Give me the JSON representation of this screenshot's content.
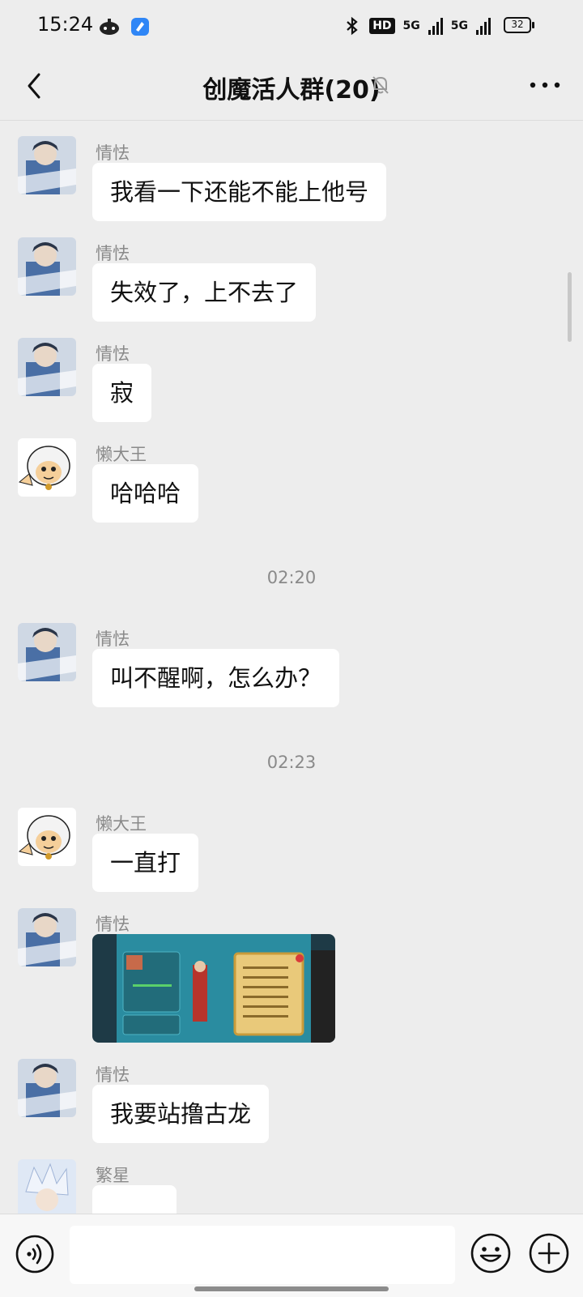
{
  "status_bar": {
    "time": "15:24",
    "hd_label": "HD",
    "sig1_label": "5G",
    "sig2_label": "5G",
    "battery": "32"
  },
  "header": {
    "title": "创魔活人群(20)",
    "back_icon": "chevron-left-icon",
    "mute_icon": "bell-off-icon",
    "more_icon": "more-dots-icon"
  },
  "messages": [
    {
      "sender": "情怯",
      "text": "我看一下还能不能上他号"
    },
    {
      "sender": "情怯",
      "text": "失效了，上不去了"
    },
    {
      "sender": "情怯",
      "text": "寂"
    },
    {
      "sender": "懒大王",
      "text": "哈哈哈"
    },
    {
      "time": "02:20"
    },
    {
      "sender": "情怯",
      "text": "叫不醒啊，怎么办？"
    },
    {
      "time": "02:23"
    },
    {
      "sender": "懒大王",
      "text": "一直打"
    },
    {
      "sender": "情怯",
      "image": "game-screenshot"
    },
    {
      "sender": "情怯",
      "text": "我要站撸古龙"
    },
    {
      "sender": "繁星",
      "text": ""
    }
  ],
  "input": {
    "placeholder": "",
    "voice_icon": "voice-icon",
    "emoji_icon": "emoji-icon",
    "plus_icon": "plus-icon"
  },
  "colors": {
    "background": "#ededed",
    "bubble": "#ffffff",
    "sender_text": "#8a8a8a"
  }
}
